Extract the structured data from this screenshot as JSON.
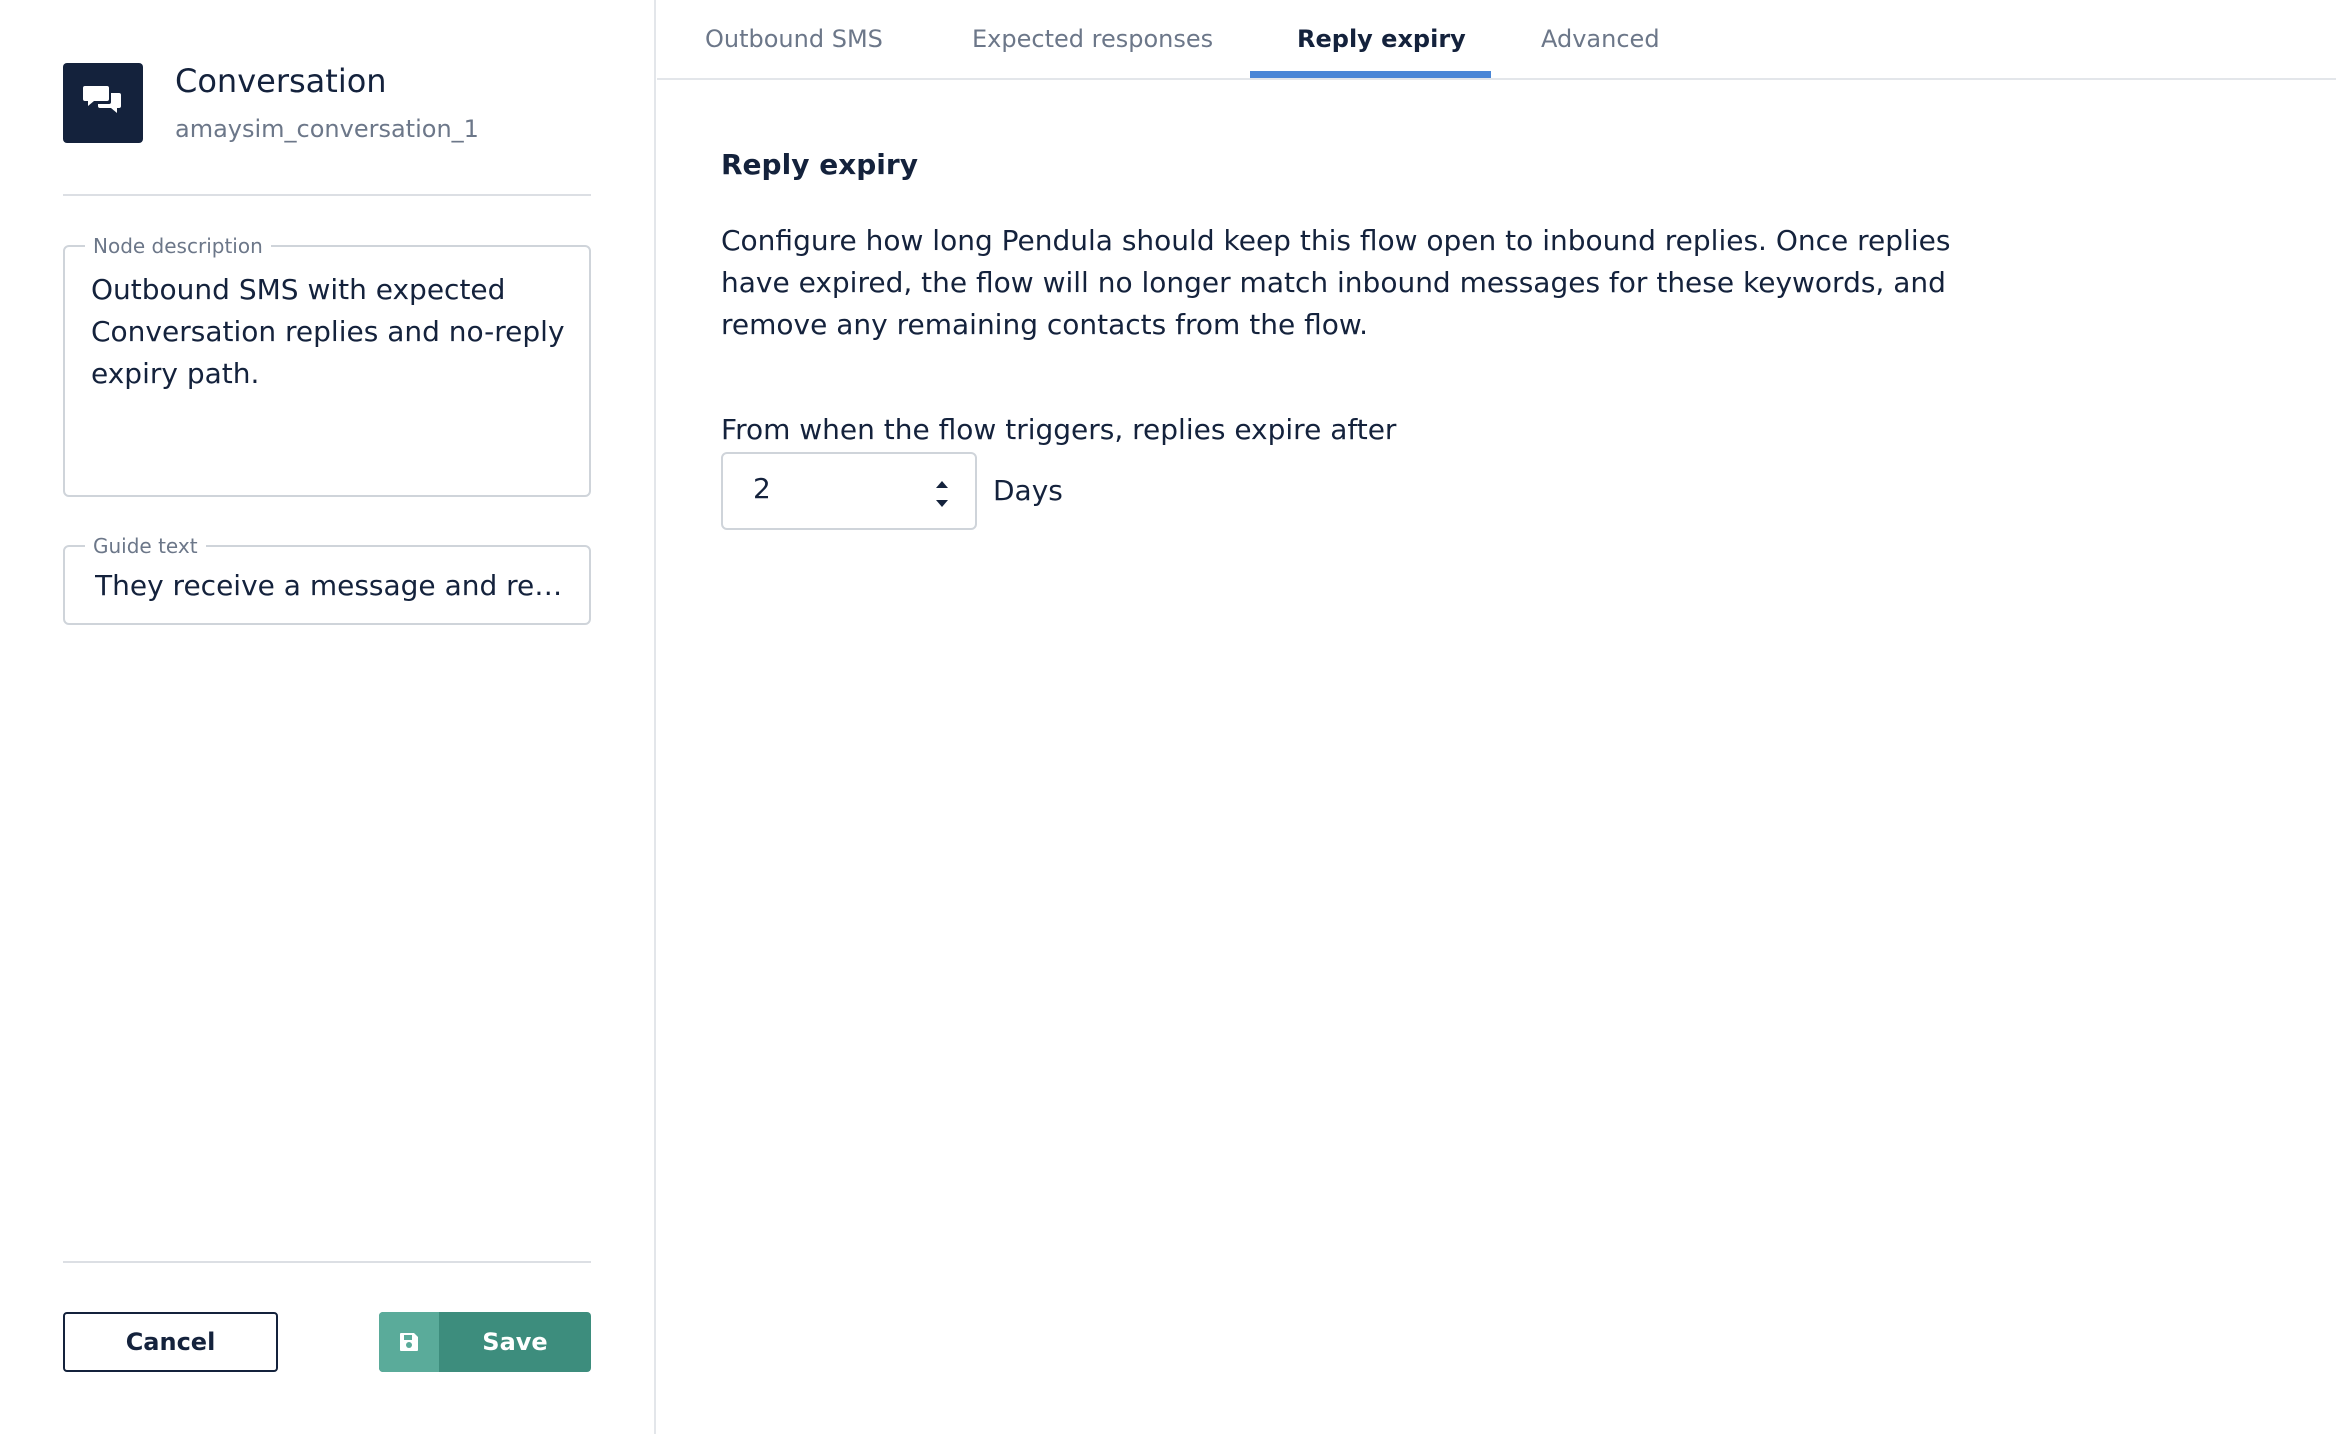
{
  "node": {
    "icon": "chat-bubbles-icon",
    "title": "Conversation",
    "id": "amaysim_conversation_1"
  },
  "description_field": {
    "legend": "Node description",
    "value": "Outbound SMS with expected Conversation replies and no-reply expiry path."
  },
  "guide_field": {
    "legend": "Guide text",
    "value": "They receive a message and reply.."
  },
  "actions": {
    "cancel_label": "Cancel",
    "save_label": "Save",
    "save_icon": "floppy-disk-icon"
  },
  "tabs": [
    {
      "label": "Outbound SMS",
      "active": false
    },
    {
      "label": "Expected responses",
      "active": false
    },
    {
      "label": "Reply expiry",
      "active": true
    },
    {
      "label": "Advanced",
      "active": false
    }
  ],
  "reply_expiry": {
    "title": "Reply expiry",
    "description": "Configure how long Pendula should keep this flow open to inbound replies. Once replies have expired, the flow will no longer match inbound messages for these keywords, and remove any remaining contacts from the flow.",
    "expire_label": "From when the flow triggers, replies expire after",
    "value": "2",
    "unit": "Days"
  },
  "colors": {
    "navy": "#14223c",
    "accent_blue": "#4a86d6",
    "save_green": "#3d8d7d",
    "muted_text": "#6c7789"
  }
}
